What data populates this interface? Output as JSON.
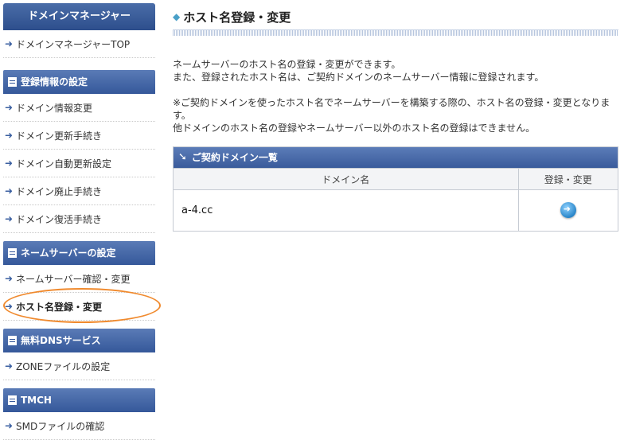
{
  "sidebar": {
    "header": "ドメインマネージャー",
    "top_item": "ドメインマネージャーTOP",
    "sections": [
      {
        "title": "登録情報の設定",
        "items": [
          "ドメイン情報変更",
          "ドメイン更新手続き",
          "ドメイン自動更新設定",
          "ドメイン廃止手続き",
          "ドメイン復活手続き"
        ]
      },
      {
        "title": "ネームサーバーの設定",
        "items": [
          "ネームサーバー確認・変更",
          "ホスト名登録・変更"
        ]
      },
      {
        "title": "無料DNSサービス",
        "items": [
          "ZONEファイルの設定"
        ]
      },
      {
        "title": "TMCH",
        "items": [
          "SMDファイルの確認"
        ]
      }
    ],
    "active_item": "ホスト名登録・変更",
    "highlight_color": "#f08a2e"
  },
  "main": {
    "title": "ホスト名登録・変更",
    "description1": [
      "ネームサーバーのホスト名の登録・変更ができます。",
      "また、登録されたホスト名は、ご契約ドメインのネームサーバー情報に登録されます。"
    ],
    "description2": [
      "※ご契約ドメインを使ったホスト名でネームサーバーを構築する際の、ホスト名の登録・変更となります。",
      "他ドメインのホスト名の登録やネームサーバー以外のホスト名の登録はできません。"
    ],
    "panel": {
      "title": "ご契約ドメイン一覧",
      "columns": [
        "ドメイン名",
        "登録・変更"
      ],
      "rows": [
        {
          "domain": "a-4.cc",
          "action_icon": "go-arrow-button-icon"
        }
      ]
    }
  },
  "colors": {
    "nav_blue": "#35589a",
    "accent_light_blue": "#4aa0c8",
    "highlight_orange": "#f08a2e"
  }
}
